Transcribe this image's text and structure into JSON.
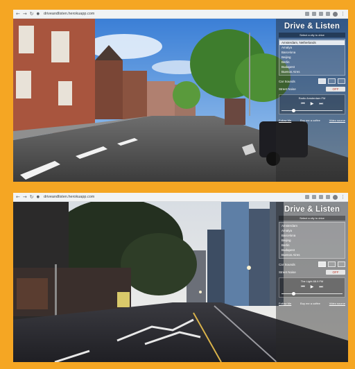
{
  "shots": [
    {
      "url": "driveandlisten.herokuapp.com",
      "scene": "amsterdam-street",
      "panel": {
        "title": "Drive & Listen",
        "subtitle": "Select a city to drive",
        "cities": [
          "Amsterdam, Netherlands",
          "Amalya",
          "Barcelona",
          "Beijing",
          "Berlin",
          "Budapest",
          "Buenos Aires"
        ],
        "selected_index": 0,
        "car_sounds_label": "Car Sounds",
        "street_noise_label": "Street Noise",
        "street_noise_value": "OFF",
        "station_title": "Radio Amsterdam FM",
        "volume": 0.2,
        "footer_left": "Follow Me",
        "footer_mid": "Buy me a coffee",
        "footer_right": "Video source"
      }
    },
    {
      "url": "driveandlisten.herokuapp.com",
      "scene": "night-city-street",
      "panel": {
        "title": "Drive & Listen",
        "subtitle": "Select a city to drive",
        "cities": [
          "Amsterdam",
          "Amalya",
          "Barcelona",
          "Beijing",
          "Berlin",
          "Budapest",
          "Buenos Aires"
        ],
        "selected_index": -1,
        "car_sounds_label": "Car Sounds",
        "street_noise_label": "Street Noise",
        "street_noise_value": "OFF",
        "station_title": "The Light 88.9 FM",
        "volume": 0.2,
        "footer_left": "Follow Me",
        "footer_mid": "Buy me a coffee",
        "footer_right": "Video source"
      }
    }
  ],
  "icons": {
    "back": "arrow-left-icon",
    "forward": "arrow-right-icon",
    "reload": "reload-icon",
    "lock": "lock-icon",
    "prev": "skip-previous-icon",
    "play": "play-icon",
    "next": "skip-next-icon"
  },
  "colors": {
    "frame": "#f5a623",
    "street_noise_text": "#c0392b"
  }
}
